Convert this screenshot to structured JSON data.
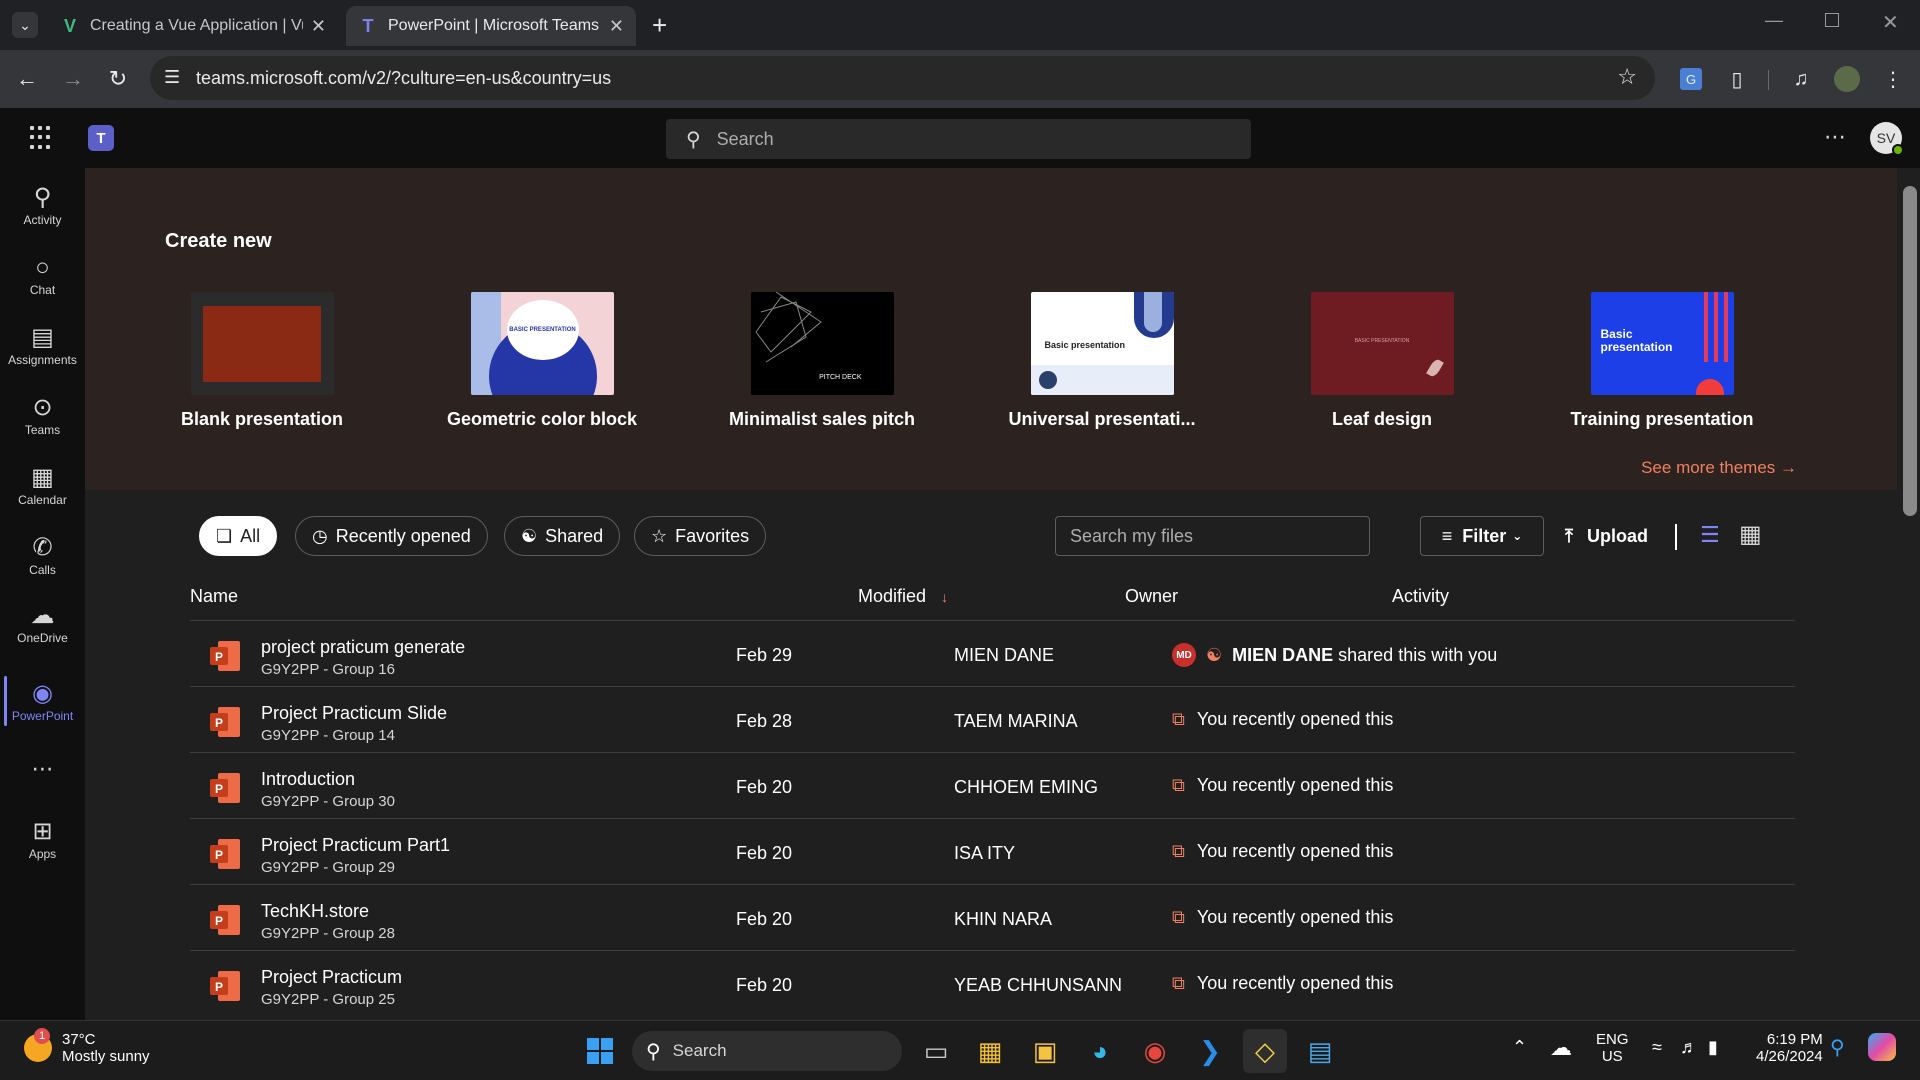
{
  "browser": {
    "tabs": [
      {
        "title": "Creating a Vue Application | Vue",
        "icon": "V"
      },
      {
        "title": "PowerPoint | Microsoft Teams",
        "icon": "T"
      }
    ],
    "url": "teams.microsoft.com/v2/?culture=en-us&country=us"
  },
  "teams": {
    "search_placeholder": "Search",
    "avatar_initials": "SV",
    "more": "⋯"
  },
  "rail": [
    {
      "label": "Activity",
      "icon": "bell-icon"
    },
    {
      "label": "Chat",
      "icon": "chat-icon"
    },
    {
      "label": "Assignments",
      "icon": "backpack-icon"
    },
    {
      "label": "Teams",
      "icon": "teams-icon"
    },
    {
      "label": "Calendar",
      "icon": "calendar-icon"
    },
    {
      "label": "Calls",
      "icon": "phone-icon"
    },
    {
      "label": "OneDrive",
      "icon": "cloud-icon"
    },
    {
      "label": "PowerPoint",
      "icon": "powerpoint-icon"
    },
    {
      "label": "Apps",
      "icon": "plus-icon"
    }
  ],
  "create": {
    "title": "Create new",
    "templates": [
      {
        "name": "Blank presentation"
      },
      {
        "name": "Geometric color block",
        "thumb_text": "BASIC PRESENTATION"
      },
      {
        "name": "Minimalist sales pitch",
        "thumb_text": "PITCH DECK"
      },
      {
        "name": "Universal presentati...",
        "thumb_text": "Basic presentation"
      },
      {
        "name": "Leaf design",
        "thumb_text": "BASIC PRESENTATION"
      },
      {
        "name": "Training presentation",
        "thumb_text": "Basic presentation"
      }
    ],
    "see_more": "See more themes →"
  },
  "files": {
    "filters": [
      "All",
      "Recently opened",
      "Shared",
      "Favorites"
    ],
    "search_placeholder": "Search my files",
    "filter_label": "Filter",
    "upload_label": "Upload",
    "columns": {
      "name": "Name",
      "modified": "Modified",
      "owner": "Owner",
      "activity": "Activity"
    },
    "rows": [
      {
        "name": "project praticum generate",
        "sub": "G9Y2PP - Group 16",
        "modified": "Feb 29",
        "owner": "MIEN DANE",
        "activity_strong": "MIEN DANE",
        "activity": " shared this with you",
        "badge": "MD"
      },
      {
        "name": "Project Practicum Slide",
        "sub": "G9Y2PP - Group 14",
        "modified": "Feb 28",
        "owner": "TAEM MARINA",
        "activity": "You recently opened this"
      },
      {
        "name": "Introduction",
        "sub": "G9Y2PP - Group 30",
        "modified": "Feb 20",
        "owner": "CHHOEM EMING",
        "activity": "You recently opened this"
      },
      {
        "name": "Project Practicum Part1",
        "sub": "G9Y2PP - Group 29",
        "modified": "Feb 20",
        "owner": "ISA ITY",
        "activity": "You recently opened this"
      },
      {
        "name": "TechKH.store",
        "sub": "G9Y2PP - Group 28",
        "modified": "Feb 20",
        "owner": "KHIN NARA",
        "activity": "You recently opened this"
      },
      {
        "name": "Project Practicum",
        "sub": "G9Y2PP - Group 25",
        "modified": "Feb 20",
        "owner": "YEAB CHHUNSANN",
        "activity": "You recently opened this"
      }
    ]
  },
  "taskbar": {
    "weather_temp": "37°C",
    "weather_desc": "Mostly sunny",
    "weather_badge": "1",
    "search": "Search",
    "lang1": "ENG",
    "lang2": "US",
    "time": "6:19 PM",
    "date": "4/26/2024"
  },
  "colors": {
    "accent": "#7f85f5",
    "link": "#f0805f",
    "ppt": "#c43e1c"
  }
}
